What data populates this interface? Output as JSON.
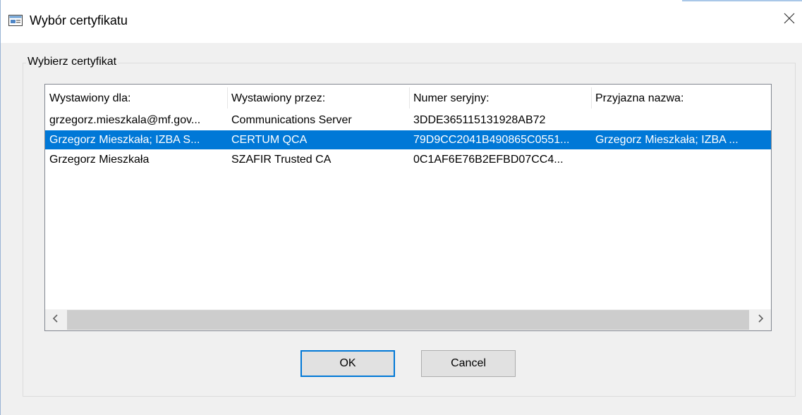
{
  "window": {
    "title": "Wybór certyfikatu",
    "icon": "certificate-card-icon",
    "close_icon": "close-icon"
  },
  "group": {
    "label": "Wybierz certyfikat"
  },
  "list": {
    "columns": [
      "Wystawiony dla:",
      "Wystawiony przez:",
      "Numer seryjny:",
      "Przyjazna nazwa:"
    ],
    "rows": [
      {
        "issued_to": "grzegorz.mieszkala@mf.gov...",
        "issued_by": "Communications Server",
        "serial": "3DDE365115131928AB72",
        "friendly_name": "",
        "selected": false
      },
      {
        "issued_to": "Grzegorz Mieszkała; IZBA S...",
        "issued_by": "CERTUM QCA",
        "serial": "79D9CC2041B490865C0551...",
        "friendly_name": "Grzegorz Mieszkała; IZBA ...",
        "selected": true
      },
      {
        "issued_to": "Grzegorz Mieszkała",
        "issued_by": "SZAFIR Trusted CA",
        "serial": "0C1AF6E76B2EFBD07CC4...",
        "friendly_name": "",
        "selected": false
      }
    ],
    "selection_color": "#0078d7"
  },
  "buttons": {
    "ok": "OK",
    "cancel": "Cancel"
  }
}
